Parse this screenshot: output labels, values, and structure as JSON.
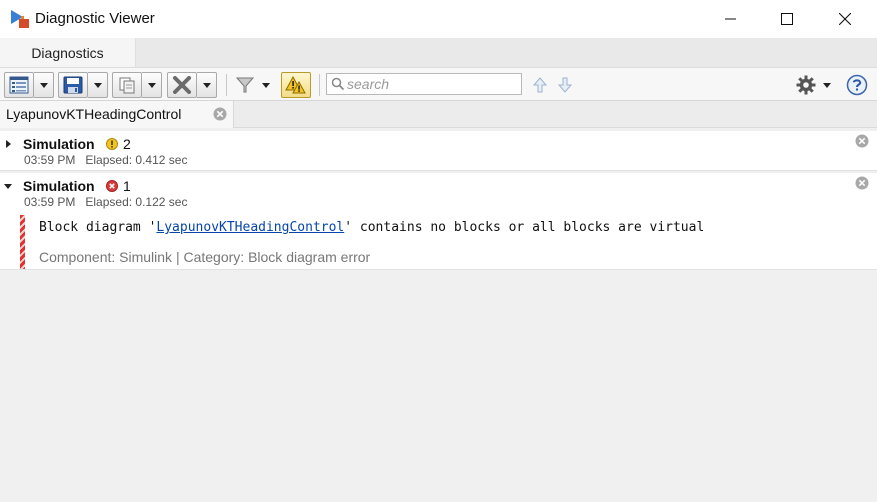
{
  "window": {
    "title": "Diagnostic Viewer"
  },
  "tabs": {
    "main_tab": "Diagnostics"
  },
  "toolbar": {
    "search_placeholder": "search"
  },
  "doc_tab": {
    "label": "LyapunovKTHeadingControl"
  },
  "runs": [
    {
      "title": "Simulation",
      "status": "warning",
      "count": "2",
      "time": "03:59 PM",
      "elapsed": "Elapsed: 0.412 sec",
      "expanded": false
    },
    {
      "title": "Simulation",
      "status": "error",
      "count": "1",
      "time": "03:59 PM",
      "elapsed": "Elapsed: 0.122 sec",
      "expanded": true,
      "message": {
        "prefix": "Block diagram '",
        "link": "LyapunovKTHeadingControl",
        "suffix": "' contains no blocks or all blocks are virtual",
        "meta": "Component:  Simulink | Category:  Block diagram error"
      }
    }
  ],
  "colors": {
    "warning": "#e8b21c",
    "error": "#d83b3b",
    "link": "#0645ad"
  }
}
